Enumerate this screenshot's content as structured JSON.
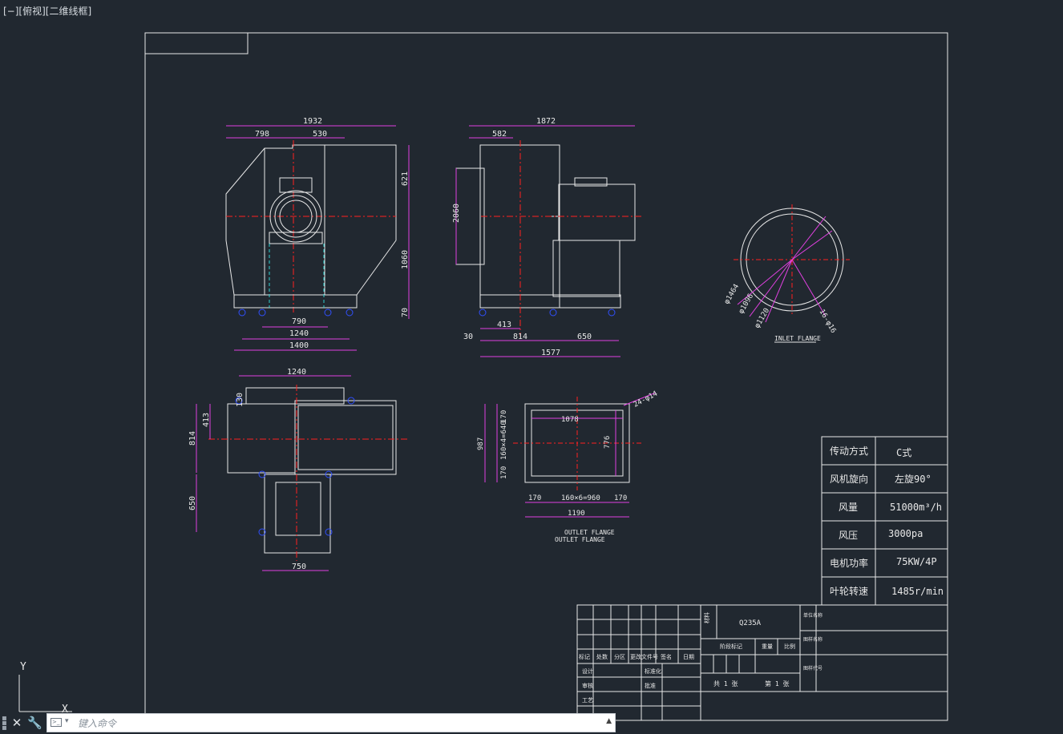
{
  "viewport": {
    "label": "[−][俯视][二维线框]"
  },
  "command_line": {
    "placeholder": "键入命令",
    "close_icon": "close-icon",
    "settings_icon": "wrench-icon"
  },
  "ucs": {
    "y": "Y",
    "x": "X"
  },
  "colors": {
    "bg": "#212830",
    "frame": "#e8e8e8",
    "dim": "#e040e0",
    "center": "#ff2020",
    "hidden": "#30d0d0",
    "bolt": "#3050ff"
  },
  "dims": {
    "front": {
      "total_w": "1932",
      "a": "798",
      "b": "530",
      "h1": "621",
      "h2": "1060",
      "h3": "70",
      "w790": "790",
      "w1240": "1240",
      "w1400": "1400"
    },
    "side": {
      "total_w": "1872",
      "a": "582",
      "h": "2060",
      "c30": "30",
      "c413": "413",
      "c814": "814",
      "c650": "650",
      "c1577": "1577"
    },
    "top": {
      "w1240": "1240",
      "h130": "130",
      "h413": "413",
      "h814": "814",
      "h650": "650",
      "w750": "750"
    },
    "outlet": {
      "d24": "24-φ14",
      "w1078": "1078",
      "h170a": "170",
      "h16": "160×4=640",
      "h987": "987",
      "h776": "776",
      "h170b": "170",
      "w170a": "170",
      "w160": "160×6=960",
      "w170b": "170",
      "w1190": "1190",
      "label1": "OUTLET FLANGE",
      "label2": "OUTLET FLANGE"
    },
    "inlet": {
      "d1": "φ1464",
      "d2": "φ1096",
      "d3": "φ1120",
      "d4": "16-φ16",
      "label": "INLET FLANGE"
    }
  },
  "spec_table": {
    "rows": [
      {
        "key": "传动方式",
        "val": "C式"
      },
      {
        "key": "风机旋向",
        "val": "左旋90°"
      },
      {
        "key": "风量",
        "val": "51000m³/h"
      },
      {
        "key": "风压",
        "val": "3000pa"
      },
      {
        "key": "电机功率",
        "val": "75KW/4P"
      },
      {
        "key": "叶轮转速",
        "val": "1485r/min"
      }
    ]
  },
  "title_block": {
    "material": "Q235A",
    "header_cells": [
      "标记",
      "处数",
      "分区",
      "更改文件号",
      "签名",
      "日期"
    ],
    "left_rows": [
      "设计",
      "审核",
      "工艺"
    ],
    "mid_rows": [
      "标准化",
      "批准"
    ],
    "stage": [
      "阶段标记",
      "重量",
      "比例"
    ],
    "sheet": {
      "total": "共 1 张",
      "this": "第 1 张"
    },
    "side_labels": [
      "材料",
      "单位名称",
      "图样名称",
      "图样代号"
    ]
  }
}
